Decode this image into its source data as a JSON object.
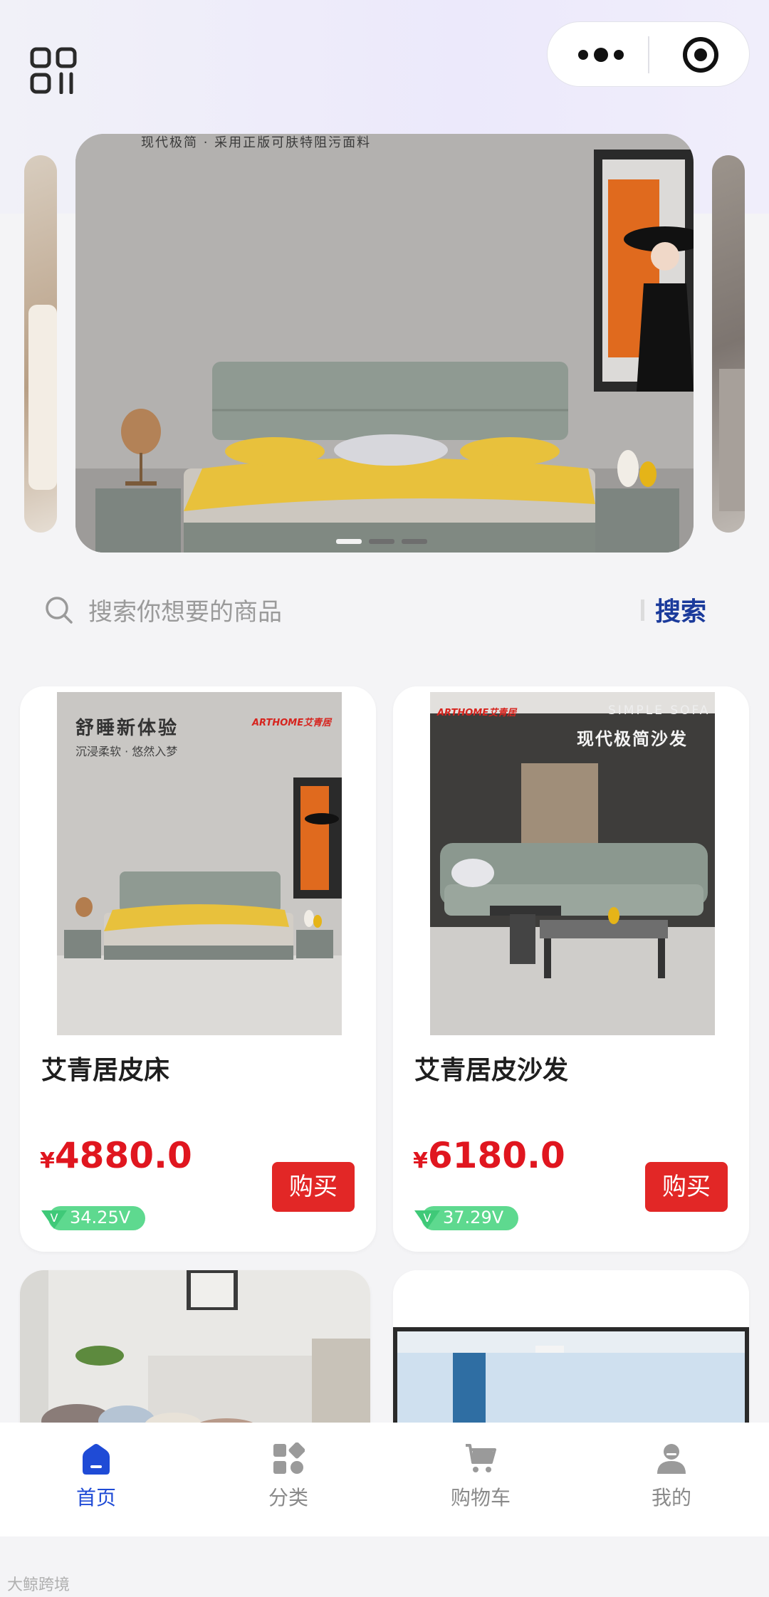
{
  "header": {
    "menu_icon": "grid-menu-icon",
    "capsule": {
      "more_icon": "more-dots-icon",
      "close_icon": "target-circle-icon"
    }
  },
  "banner": {
    "caption": "现代极简 · 采用正版可肤特阻污面料",
    "indicator_count": 3,
    "active_index": 0
  },
  "search": {
    "placeholder": "搜索你想要的商品",
    "button_label": "搜索"
  },
  "products": [
    {
      "title": "艾青居皮床",
      "price_symbol": "¥",
      "price": "4880.0",
      "buy_label": "购买",
      "v_value": "34.25V",
      "image_text": "舒睡新体验",
      "image_sub": "沉浸柔软 · 悠然入梦",
      "brand": "ARTHOME艾青居"
    },
    {
      "title": "艾青居皮沙发",
      "price_symbol": "¥",
      "price": "6180.0",
      "buy_label": "购买",
      "v_value": "37.29V",
      "image_text": "现代极简沙发",
      "image_sub": "SIMPLE SOFA",
      "brand": "ARTHOME艾青居"
    }
  ],
  "tabbar": [
    {
      "label": "首页",
      "icon": "home-icon",
      "active": true
    },
    {
      "label": "分类",
      "icon": "category-icon",
      "active": false
    },
    {
      "label": "购物车",
      "icon": "cart-icon",
      "active": false
    },
    {
      "label": "我的",
      "icon": "user-icon",
      "active": false
    }
  ],
  "watermark": "大鲸跨境",
  "colors": {
    "accent": "#1f4bd6",
    "price": "#e0161f",
    "buy": "#e22726",
    "badge": "#5ed98f",
    "search_button": "#1a3a9b"
  }
}
